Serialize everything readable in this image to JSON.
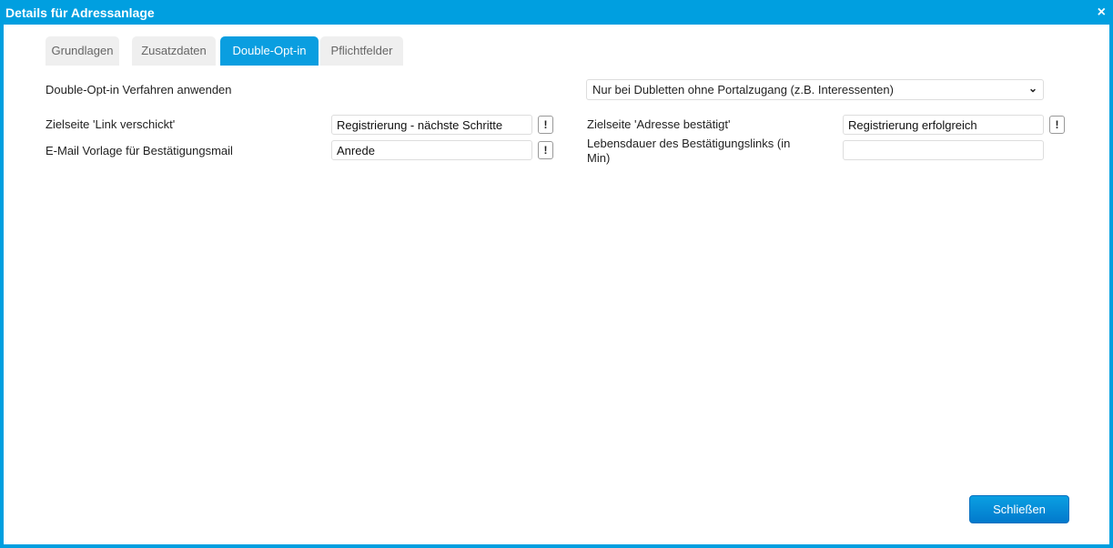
{
  "window": {
    "title": "Details für Adressanlage",
    "close_icon": "×"
  },
  "tabs": [
    {
      "label": "Grundlagen"
    },
    {
      "label": "Zusatzdaten"
    },
    {
      "label": "Double-Opt-in",
      "active": true
    },
    {
      "label": "Pflichtfelder"
    }
  ],
  "form": {
    "doi_label": "Double-Opt-in Verfahren anwenden",
    "doi_value": "Nur bei Dubletten ohne Portalzugang (z.B. Interessenten)",
    "link_label": "Zielseite 'Link verschickt'",
    "link_value": "Registrierung - nächste Schritte",
    "mail_label": "E-Mail Vorlage für Bestätigungsmail",
    "mail_value": "Anrede",
    "confirmed_label": "Zielseite 'Adresse bestätigt'",
    "confirmed_value": "Registrierung erfolgreich",
    "lifetime_label": "Lebensdauer des Bestätigungslinks (in Min)",
    "lifetime_value": "",
    "excl": "!"
  },
  "footer": {
    "close_label": "Schließen"
  }
}
